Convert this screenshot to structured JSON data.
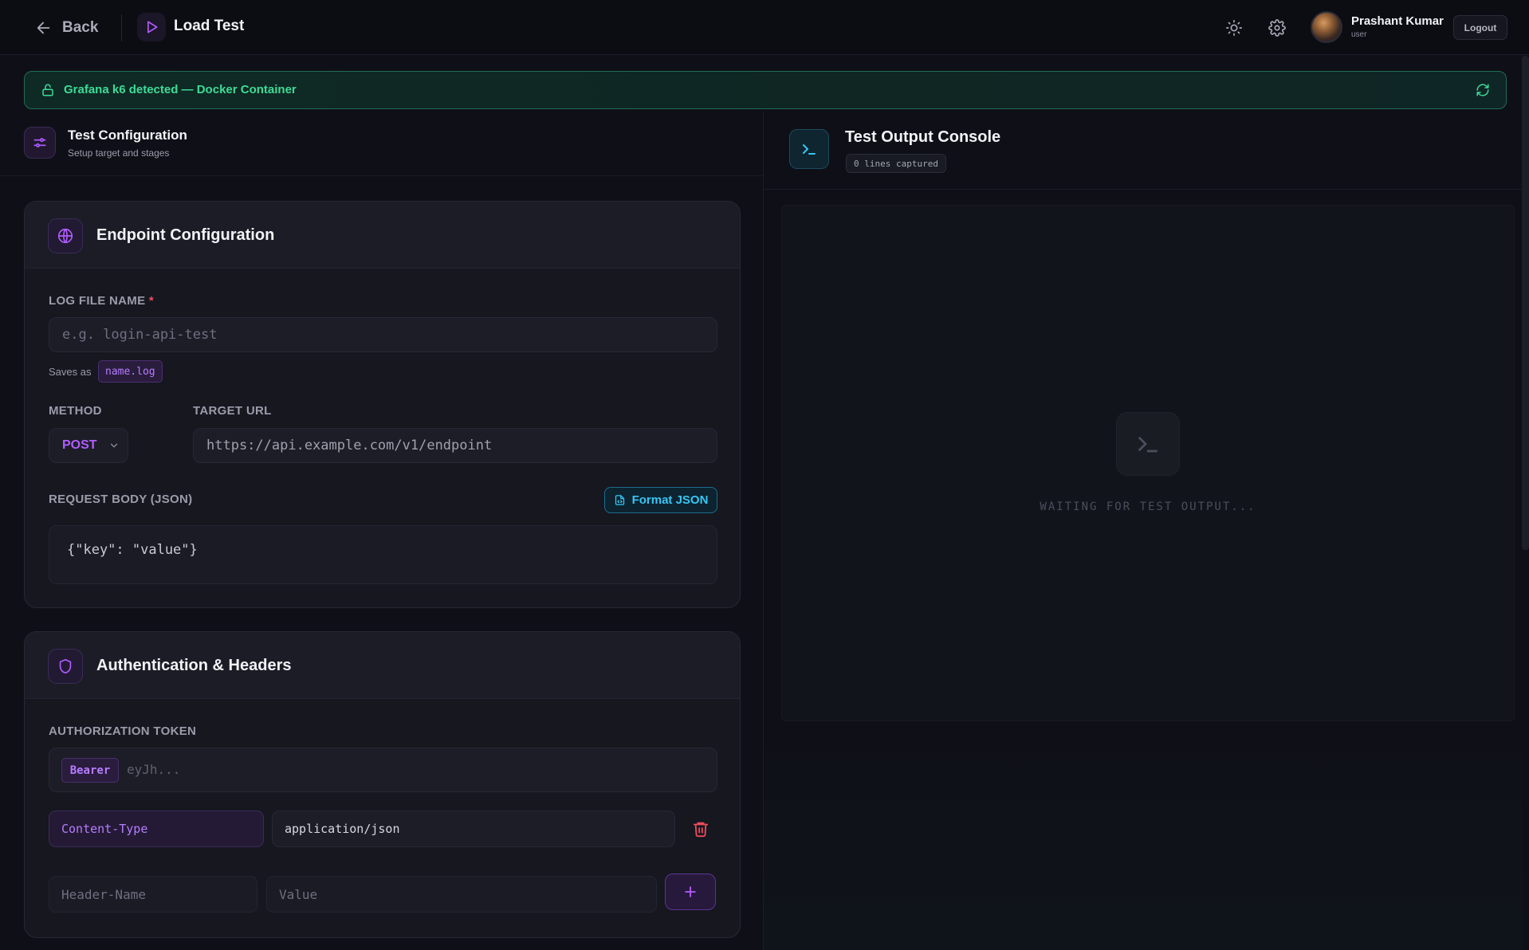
{
  "topbar": {
    "back_label": "Back",
    "page_title": "Load Test",
    "user_name": "Prashant Kumar",
    "user_role": "user",
    "logout_label": "Logout"
  },
  "banner": {
    "text": "Grafana k6 detected — Docker Container",
    "color": "#3ddc97"
  },
  "config_header": {
    "title": "Test Configuration",
    "subtitle": "Setup target and stages"
  },
  "endpoint": {
    "title": "Endpoint Configuration",
    "log_label": "LOG FILE NAME",
    "required_mark": "*",
    "log_placeholder": "e.g. login-api-test",
    "saves_as_label": "Saves as",
    "saves_as_value": "name.log",
    "method_label": "METHOD",
    "method_value": "POST",
    "url_label": "TARGET URL",
    "url_placeholder": "https://api.example.com/v1/endpoint",
    "body_label": "REQUEST BODY (JSON)",
    "format_label": "Format JSON",
    "body_value": "{\"key\": \"value\"}"
  },
  "auth": {
    "title": "Authentication & Headers",
    "token_label": "AUTHORIZATION TOKEN",
    "bearer_chip": "Bearer",
    "token_placeholder": "eyJh...",
    "headers": [
      {
        "name": "Content-Type",
        "value": "application/json"
      }
    ],
    "new_header_placeholder": "Header-Name",
    "new_value_placeholder": "Value"
  },
  "console": {
    "title": "Test Output Console",
    "lines_badge": "0 lines captured",
    "waiting_text": "WAITING FOR TEST OUTPUT..."
  },
  "icons": {
    "back": "arrow-left-icon",
    "page": "play-icon",
    "theme": "sun-icon",
    "settings": "gear-icon",
    "banner": "lock-icon",
    "refresh": "refresh-icon",
    "config": "sliders-icon",
    "endpoint": "globe-icon",
    "auth": "shield-icon",
    "console": "terminal-icon",
    "trash": "trash-icon",
    "add": "plus-icon"
  },
  "colors": {
    "accent": "#b15cff",
    "info": "#38c6f4",
    "danger": "#ef4b5c",
    "success": "#3ddc97"
  }
}
